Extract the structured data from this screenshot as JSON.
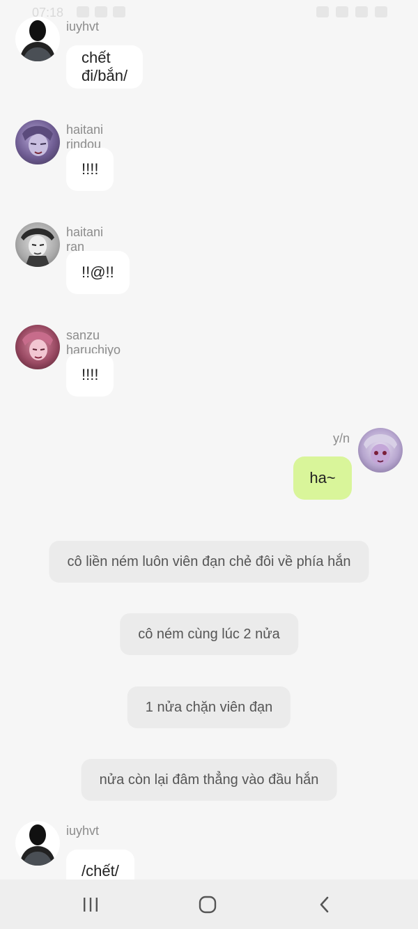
{
  "status": {
    "time": "07:18"
  },
  "messages": [
    {
      "sender": "iuyhvt",
      "text": "chết đi/bắn/",
      "avatar": "silhouette-icon"
    },
    {
      "sender": "haitani rindou",
      "text": "!!!!",
      "avatar": "anime-avatar-purple"
    },
    {
      "sender": "haitani ran",
      "text": "!!@!!",
      "avatar": "anime-avatar-gray"
    },
    {
      "sender": "sanzu haruchiyo",
      "text": "!!!!",
      "avatar": "anime-avatar-pink"
    },
    {
      "sender": "y/n",
      "text": "ha~",
      "avatar": "anime-avatar-lilac"
    }
  ],
  "narrations": [
    "cô liền ném luôn viên đạn chẻ đôi về phía hắn",
    "cô ném cùng lúc 2 nửa",
    "1 nửa chặn viên đạn",
    "nửa còn lại đâm thẳng vào đầu hắn"
  ],
  "last_message": {
    "sender": "iuyhvt",
    "text": "/chết/",
    "avatar": "silhouette-icon"
  },
  "colors": {
    "background": "#f6f6f6",
    "my_bubble": "#d9f59a",
    "bubble": "#ffffff",
    "narration": "#ebebeb"
  }
}
